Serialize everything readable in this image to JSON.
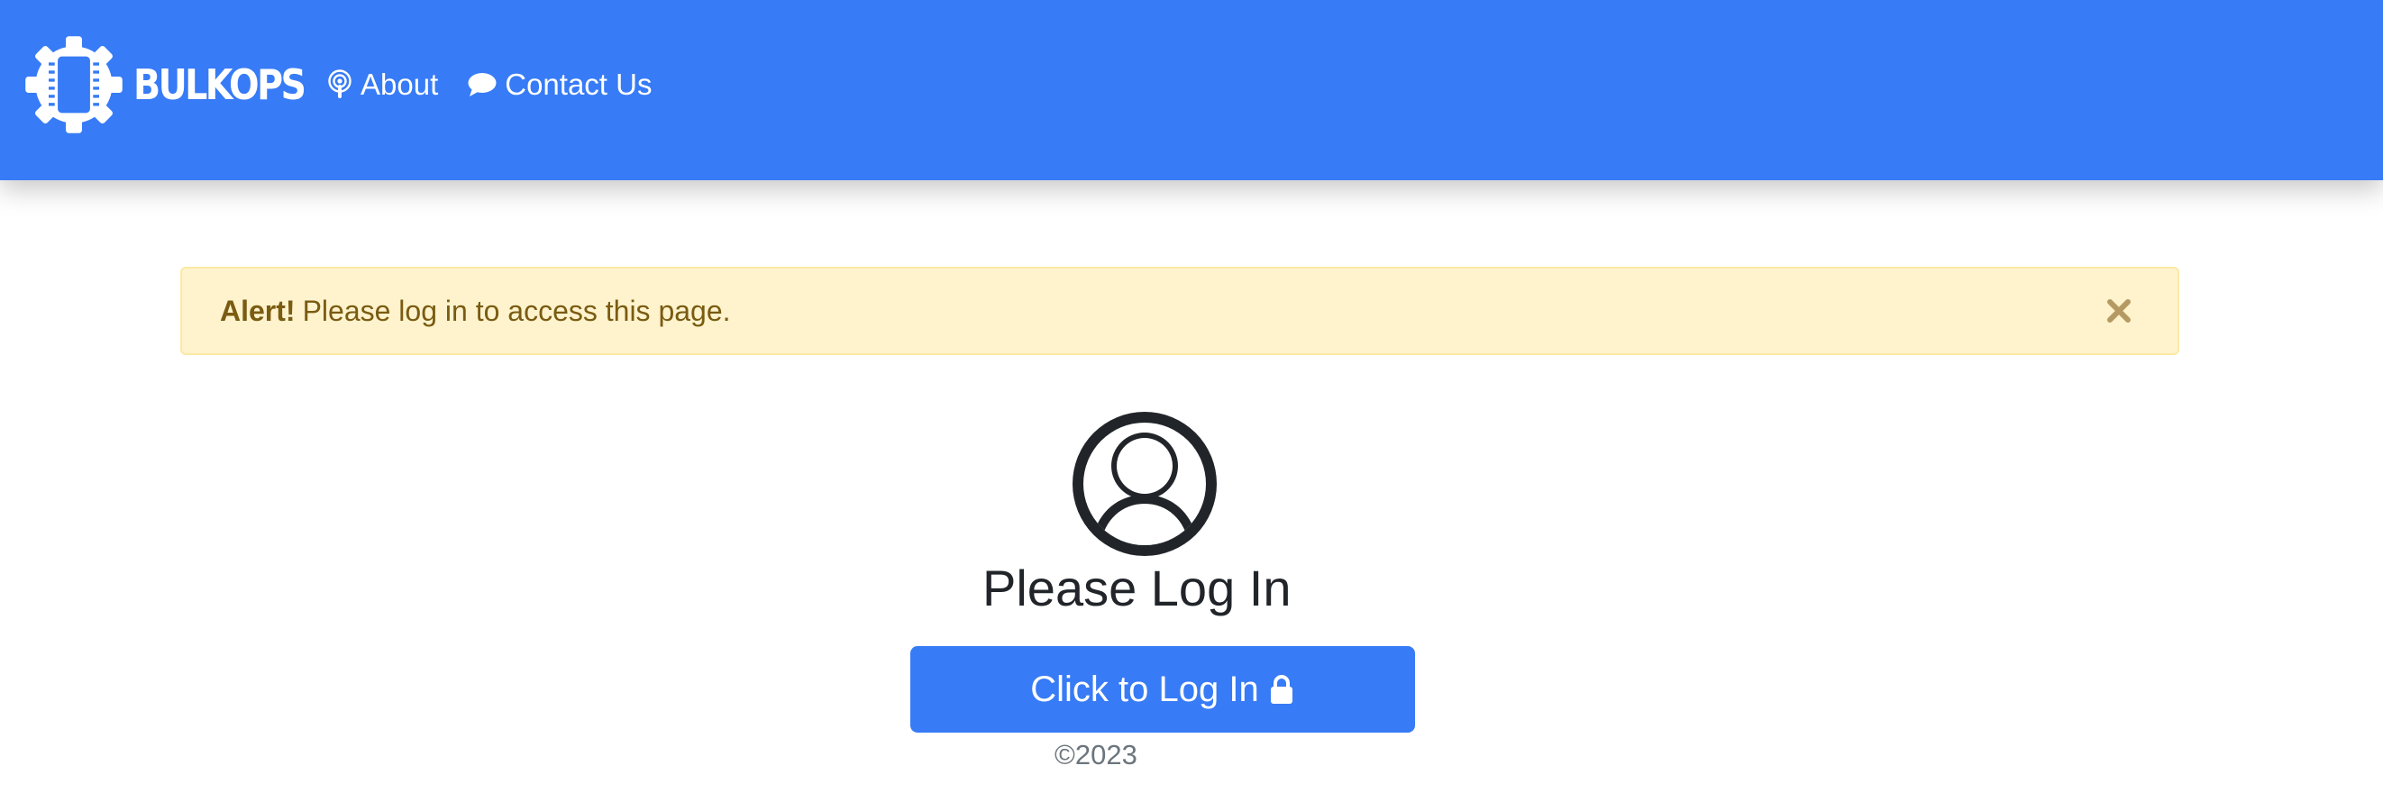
{
  "brand": {
    "name": "BULKOPS",
    "logo_icon": "gear-chip-icon"
  },
  "nav": {
    "items": [
      {
        "label": "About",
        "icon": "podcast-icon"
      },
      {
        "label": "Contact Us",
        "icon": "chat-bubble-icon"
      }
    ]
  },
  "alert": {
    "strong": "Alert!",
    "message": "Please log in to access this page.",
    "close_icon": "close-icon"
  },
  "login": {
    "avatar_icon": "user-circle-icon",
    "title": "Please Log In",
    "button_label": "Click to Log In",
    "button_icon": "lock-icon"
  },
  "footer": {
    "copyright": "©2023"
  },
  "colors": {
    "primary": "#377bf6",
    "alert_bg": "#fef3cd",
    "alert_border": "#fde9a6",
    "alert_text": "#7a5b12",
    "heading_text": "#212529",
    "muted_text": "#6c757d"
  }
}
